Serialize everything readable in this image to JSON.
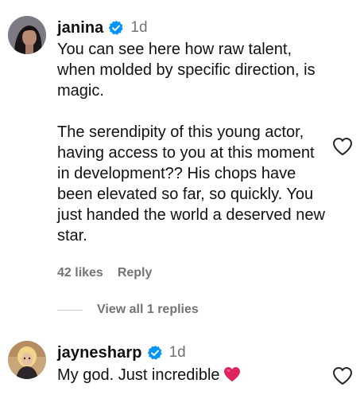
{
  "comments": [
    {
      "username": "janina",
      "time": "1d",
      "paragraphs": [
        "You can see here how raw talent, when molded by specific direction, is magic.",
        "The serendipity of this young actor, having access to you at this moment in development?? His chops have been elevated so far, so quickly. You just handed the world a deserved new star."
      ],
      "likes": "42 likes",
      "reply": "Reply",
      "view_replies": "View all 1 replies"
    },
    {
      "username": "jaynesharp",
      "time": "1d",
      "text": "My god. Just incredible"
    }
  ],
  "colors": {
    "verified": "#0095f6",
    "muted": "#737373",
    "heart_emoji": "#e0245e"
  },
  "icons": [
    "verified-badge-icon",
    "heart-outline-icon",
    "red-heart-emoji-icon"
  ]
}
